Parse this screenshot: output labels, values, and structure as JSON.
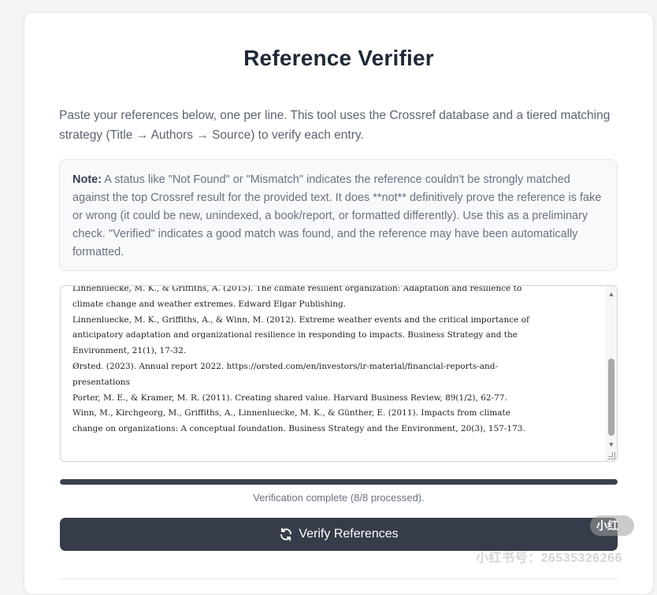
{
  "page": {
    "title": "Reference Verifier",
    "intro": "Paste your references below, one per line. This tool uses the Crossref database and a tiered matching strategy (Title → Authors → Source) to verify each entry."
  },
  "note": {
    "label": "Note:",
    "text": " A status like \"Not Found\" or \"Mismatch\" indicates the reference couldn't be strongly matched against the top Crossref result for the provided text. It does **not** definitively prove the reference is fake or wrong (it could be new, unindexed, a book/report, or formatted differently). Use this as a preliminary check. \"Verified\" indicates a good match was found, and the reference may have been automatically formatted."
  },
  "references_input": {
    "value": "Linnenluecke, M. K., & Griffiths, A. (2015). The climate resilient organization: Adaptation and resilience to\nclimate change and weather extremes. Edward Elgar Publishing.\nLinnenluecke, M. K., Griffiths, A., & Winn, M. (2012). Extreme weather events and the critical importance of\nanticipatory adaptation and organizational resilience in responding to impacts. Business Strategy and the\nEnvironment, 21(1), 17-32.\nØrsted. (2023). Annual report 2022. https://orsted.com/en/investors/ir-material/financial-reports-and-\npresentations\nPorter, M. E., & Kramer, M. R. (2011). Creating shared value. Harvard Business Review, 89(1/2), 62-77.\nWinn, M., Kirchgeorg, M., Griffiths, A., Linnenluecke, M. K., & Günther, E. (2011). Impacts from climate\nchange on organizations: A conceptual foundation. Business Strategy and the Environment, 20(3), 157-173."
  },
  "progress": {
    "fraction": 1.0,
    "status_text": "Verification complete (8/8 processed)."
  },
  "actions": {
    "verify_label": "Verify References",
    "verify_icon": "refresh-icon"
  },
  "overlay": {
    "badge": "小红",
    "watermark": "小红书号：26535326266"
  },
  "colors": {
    "button_bg": "#363c49",
    "progress_fill": "#3b414d",
    "note_bg": "#f7f9fb"
  }
}
